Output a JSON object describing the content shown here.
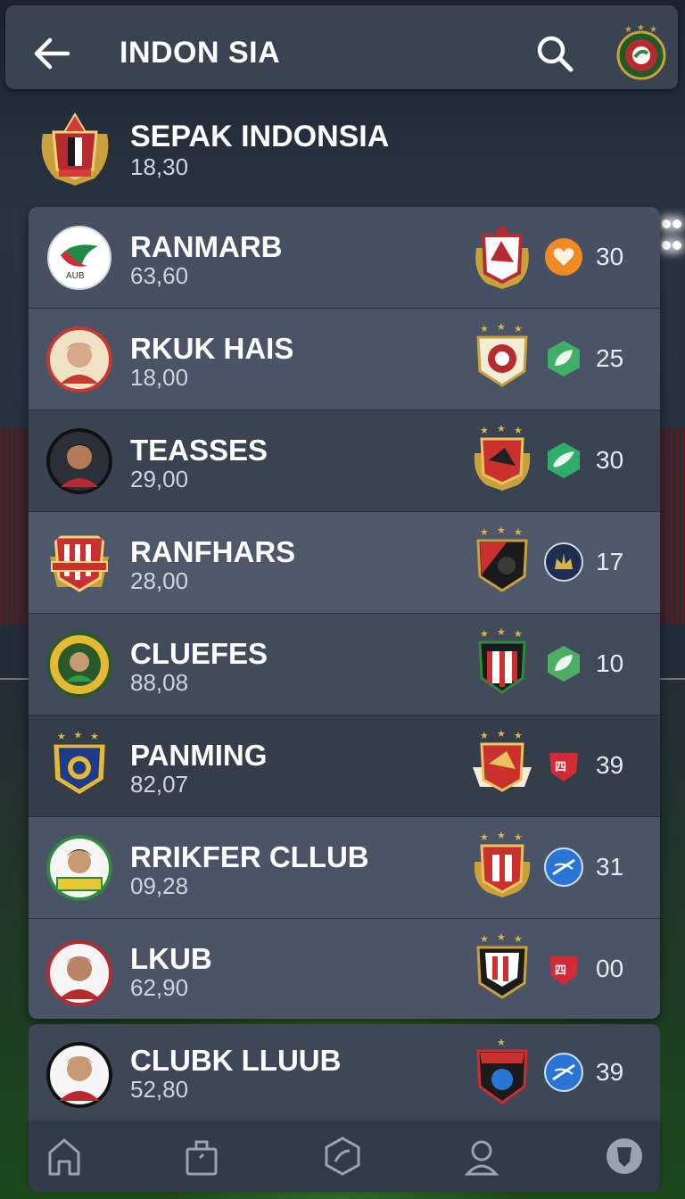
{
  "header": {
    "title": "INDON SIA",
    "back_icon": "arrow-left-icon",
    "search_icon": "search-icon",
    "badge_icon": "club-badge-icon"
  },
  "league": {
    "name": "SEPAK INDONSIA",
    "score": "18,30",
    "crest_icon": "league-crest-icon"
  },
  "rows": [
    {
      "name": "RANMARB",
      "value": "63,60",
      "stat": "30",
      "stat_icon": "heart-icon",
      "stat_color": "#f08a24"
    },
    {
      "name": "RKUK HAIS",
      "value": "18,00",
      "stat": "25",
      "stat_icon": "leaf-icon",
      "stat_color": "#3fae66"
    },
    {
      "name": "TEASSES",
      "value": "29,00",
      "stat": "30",
      "stat_icon": "leaf-icon",
      "stat_color": "#2fae6a"
    },
    {
      "name": "RANFHARS",
      "value": "28,00",
      "stat": "17",
      "stat_icon": "crown-icon",
      "stat_color": "#1e2e52"
    },
    {
      "name": "CLUEFES",
      "value": "88,08",
      "stat": "10",
      "stat_icon": "leaf-icon",
      "stat_color": "#4dae63"
    },
    {
      "name": "PANMING",
      "value": "82,07",
      "stat": "39",
      "stat_icon": "shield-icon",
      "stat_color": "#d22a36"
    },
    {
      "name": "RRIKFER CLLUB",
      "value": "09,28",
      "stat": "31",
      "stat_icon": "globe-icon",
      "stat_color": "#2a74d6"
    },
    {
      "name": "LKUB",
      "value": "62,90",
      "stat": "00",
      "stat_icon": "shield-icon",
      "stat_color": "#d22a36"
    },
    {
      "name": "CLUBK LLUUB",
      "value": "52,80",
      "stat": "39",
      "stat_icon": "globe-icon",
      "stat_color": "#2a74d6"
    }
  ],
  "nav": [
    {
      "icon": "home-icon"
    },
    {
      "icon": "bag-icon"
    },
    {
      "icon": "hexagon-icon"
    },
    {
      "icon": "user-icon"
    },
    {
      "icon": "shield-icon"
    }
  ],
  "colors": {
    "panel": "#3e4757",
    "header": "#3a4352",
    "accent_red": "#d22a36",
    "accent_green": "#3fae66",
    "accent_orange": "#f08a24",
    "accent_blue": "#2a74d6"
  }
}
